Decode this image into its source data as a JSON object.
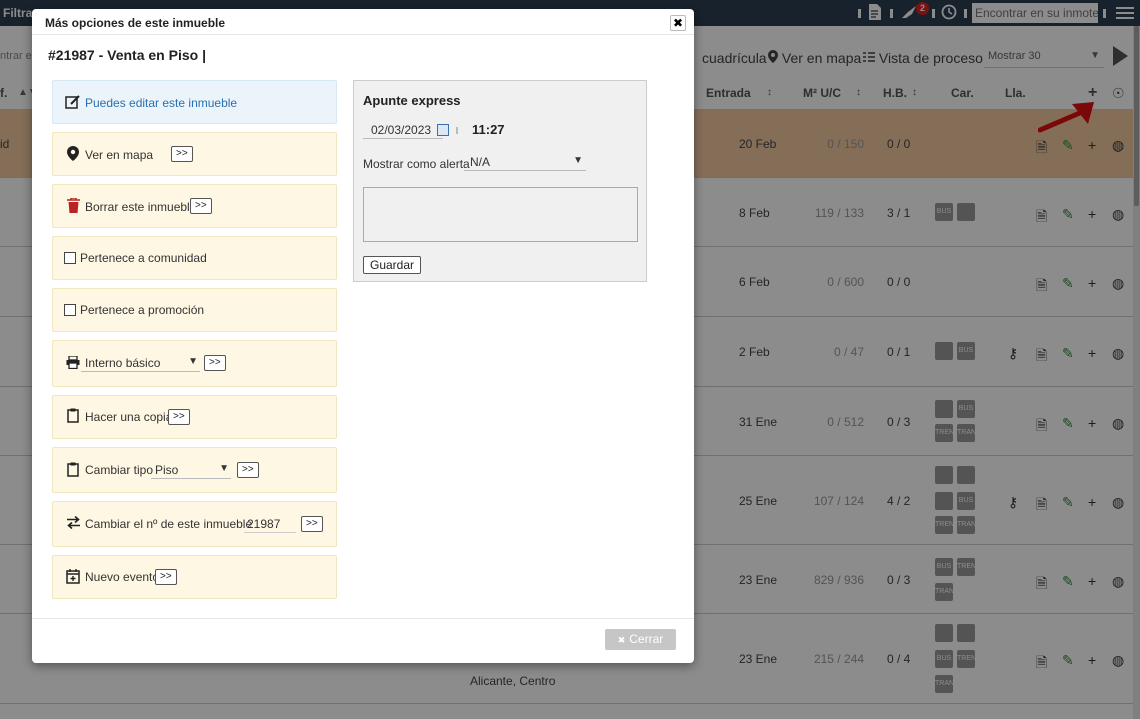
{
  "topbar": {
    "filter_label": "Filtra",
    "search_placeholder": "Encontrar en su inmotek",
    "notification_count": "2"
  },
  "toolbar": {
    "entrar_placeholder": "ntrar e",
    "cuadricula_label": "cuadrícula",
    "map_label": "Ver en mapa",
    "process_label": "Vista de proceso",
    "show_select": "Mostrar 30"
  },
  "table": {
    "headers": {
      "ref": "f.",
      "entrada": "Entrada",
      "m2": "M² U/C",
      "hb": "H.B.",
      "car": "Car.",
      "lla": "Lla."
    },
    "rows": [
      {
        "first": "id",
        "date": "20 Feb",
        "m2": "0 / 150",
        "hb": "0 / 0"
      },
      {
        "first": "",
        "date": "8 Feb",
        "m2": "119 / 133",
        "hb": "3 / 1"
      },
      {
        "first": "",
        "date": "6 Feb",
        "m2": "0 / 600",
        "hb": "0 / 0"
      },
      {
        "first": "",
        "date": "2 Feb",
        "m2": "0 / 47",
        "hb": "0 / 1"
      },
      {
        "first": "",
        "date": "31 Ene",
        "m2": "0 / 512",
        "hb": "0 / 3"
      },
      {
        "first": "",
        "date": "25 Ene",
        "m2": "107 / 124",
        "hb": "4 / 2"
      },
      {
        "first": "",
        "date": "23 Ene",
        "m2": "829 / 936",
        "hb": "0 / 3"
      },
      {
        "first": "",
        "date": "23 Ene",
        "m2": "215 / 244",
        "hb": "0 / 4",
        "address": "Alicante, Centro"
      }
    ]
  },
  "modal": {
    "title": "Más opciones de este inmueble",
    "property_title": "#21987 - Venta en Piso |",
    "go_label": ">>",
    "options": {
      "edit": "Puedes editar este inmueble",
      "map": "Ver en mapa",
      "delete": "Borrar este inmueble",
      "community": "Pertenece a comunidad",
      "promotion": "Pertenece a promoción",
      "print_select": "Interno básico",
      "copy": "Hacer una copia",
      "change_type": "Cambiar tipo",
      "type_select": "Piso",
      "change_number": "Cambiar el nº de este inmueble",
      "number_value": "21987",
      "new_event": "Nuevo evento"
    },
    "express": {
      "title": "Apunte express",
      "date": "02/03/2023",
      "time": "11:27",
      "alert_label": "Mostrar como alerta",
      "alert_value": "N/A",
      "save_label": "Guardar"
    },
    "close_label": "Cerrar"
  },
  "colors": {
    "topbar": "#2c3e50",
    "highlight_row": "#f0c8a0",
    "option_bg": "#fdf7e3",
    "edit_green": "#2e8b3a"
  }
}
